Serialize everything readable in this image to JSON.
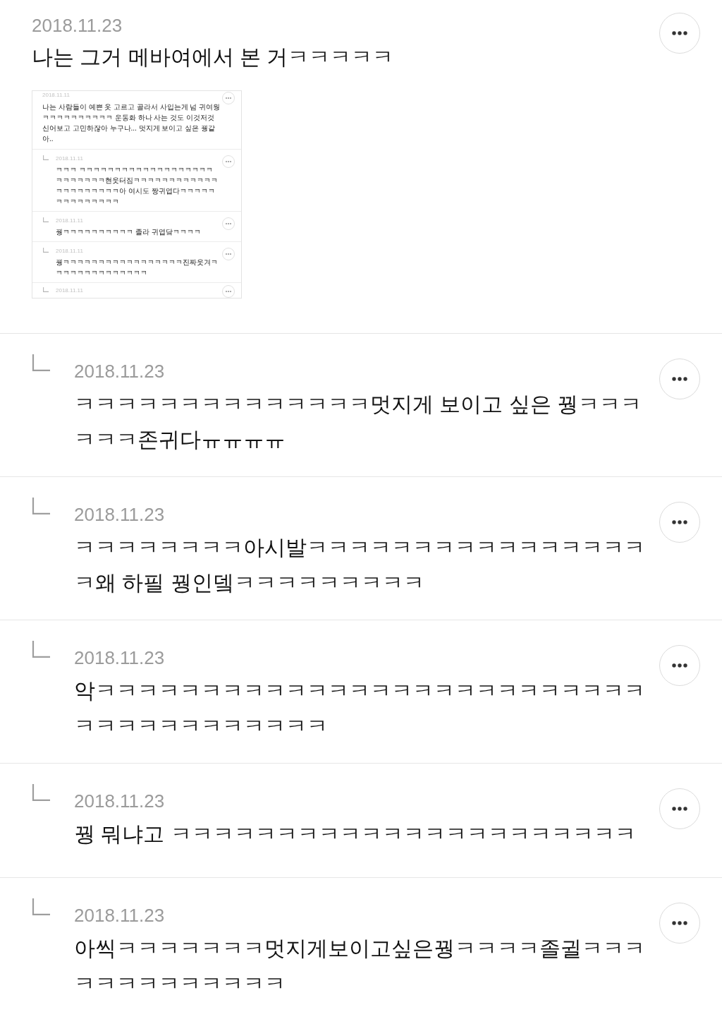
{
  "comments": [
    {
      "kind": "comment",
      "date": "2018.11.23",
      "text": "나는 그거 메바여에서 본 거ㅋㅋㅋㅋㅋ",
      "screenshot": {
        "comments": [
          {
            "kind": "comment",
            "date": "2018.11.11",
            "text": "나는 사람들이 예쁜 옷 고르고 골라서 사입는게 넘 귀여웡 ㅋㅋㅋㅋㅋㅋㅋㅋㅋㅋ 운동화 하나 사는 것도 이것저것 신어보고 고민하잖아 누구나... 멋지게 보이고 싶은 꿩같아.."
          },
          {
            "kind": "reply",
            "date": "2018.11.11",
            "text": "ㅋㅋㅋ ㅋㅋㅋㅋㅋㅋㅋㅋㅋㅋㅋㅋㅋㅋㅋㅋㅋㅋㅋㅋㅋㅋㅋㅋㅋㅋ현웃터짐ㅋㅋㅋㅋㅋㅋㅋㅋㅋㅋㅋㅋㅋㅋㅋㅋㅋㅋㅋㅋㅋ아 여시도 짱귀엽다ㅋㅋㅋㅋㅋㅋㅋㅋㅋㅋㅋㅋㅋㅋ"
          },
          {
            "kind": "reply",
            "date": "2018.11.11",
            "text": "꿩ㅋㅋㅋㅋㅋㅋㅋㅋㅋㅋ 졸라 귀엽닼ㅋㅋㅋㅋ"
          },
          {
            "kind": "reply",
            "date": "2018.11.11",
            "text": "꿩ㅋㅋㅋㅋㅋㅋㅋㅋㅋㅋㅋㅋㅋㅋㅋㅋㅋ진짜웃겨ㅋㅋㅋㅋㅋㅋㅋㅋㅋㅋㅋㅋㅋㅋ"
          },
          {
            "kind": "reply",
            "date": "2018.11.11"
          }
        ]
      }
    },
    {
      "kind": "reply",
      "date": "2018.11.23",
      "text": "ㅋㅋㅋㅋㅋㅋㅋㅋㅋㅋㅋㅋㅋㅋ멋지게 보이고 싶은 꿩ㅋㅋㅋㅋㅋㅋ존귀다ㅠㅠㅠㅠ"
    },
    {
      "kind": "reply",
      "date": "2018.11.23",
      "text": "ㅋㅋㅋㅋㅋㅋㅋㅋ아시발ㅋㅋㅋㅋㅋㅋㅋㅋㅋㅋㅋㅋㅋㅋㅋㅋㅋ왜 하필 꿩인뎈ㅋㅋㅋㅋㅋㅋㅋㅋㅋ"
    },
    {
      "kind": "reply",
      "date": "2018.11.23",
      "text": "악ㅋㅋㅋㅋㅋㅋㅋㅋㅋㅋㅋㅋㅋㅋㅋㅋㅋㅋㅋㅋㅋㅋㅋㅋㅋㅋㅋㅋㅋㅋㅋㅋㅋㅋㅋㅋㅋㅋ"
    },
    {
      "kind": "reply",
      "date": "2018.11.23",
      "text": "꿩 뭐냐고 ㅋㅋㅋㅋㅋㅋㅋㅋㅋㅋㅋㅋㅋㅋㅋㅋㅋㅋㅋㅋㅋㅋ"
    },
    {
      "kind": "reply",
      "date": "2018.11.23",
      "text": "아씩ㅋㅋㅋㅋㅋㅋㅋ멋지게보이고싶은꿩ㅋㅋㅋㅋ졸귈ㅋㅋㅋㅋㅋㅋㅋㅋㅋㅋㅋㅋㅋ"
    }
  ]
}
